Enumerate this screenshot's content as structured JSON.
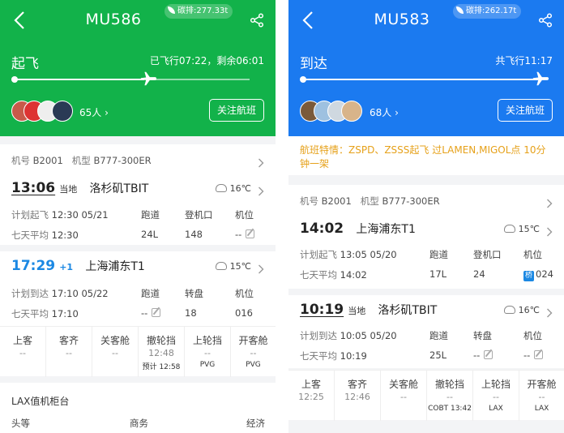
{
  "left": {
    "flight_no": "MU586",
    "carbon": "碳排:277.33t",
    "status": "起飞",
    "progress_text": "已飞行07:22，剩余06:01",
    "progress": 0.55,
    "pax": "65人",
    "follow_label": "关注航班",
    "aircraft_reg_label": "机号",
    "aircraft_reg": "B2001",
    "aircraft_type_label": "机型",
    "aircraft_type": "B777-300ER",
    "dep": {
      "time": "13:06",
      "local": "当地",
      "airport": "洛杉矶TBIT",
      "temp": "16℃",
      "plan_label": "计划起飞",
      "plan": "12:30 05/21",
      "avg_label": "七天平均",
      "avg": "12:30",
      "col1_label": "跑道",
      "col1": "24L",
      "col2_label": "登机口",
      "col2": "148",
      "col3_label": "机位",
      "col3": "--"
    },
    "arr": {
      "time": "17:29",
      "plus": "+1",
      "airport": "上海浦东T1",
      "temp": "15℃",
      "plan_label": "计划到达",
      "plan": "17:10 05/22",
      "avg_label": "七天平均",
      "avg": "17:10",
      "col1_label": "跑道",
      "col1": "--",
      "col2_label": "转盘",
      "col2": "18",
      "col3_label": "机位",
      "col3": "016"
    },
    "steps": [
      {
        "label": "上客",
        "value": "--",
        "sub": ""
      },
      {
        "label": "客齐",
        "value": "--",
        "sub": ""
      },
      {
        "label": "关客舱",
        "value": "--",
        "sub": ""
      },
      {
        "label": "撤轮挡",
        "value": "12:48",
        "sub": "预计 12:58"
      },
      {
        "label": "上轮挡",
        "value": "--",
        "sub": "PVG"
      },
      {
        "label": "开客舱",
        "value": "--",
        "sub": "PVG"
      }
    ],
    "counter_title": "LAX值机柜台",
    "counter_classes": [
      "头等",
      "商务",
      "经济"
    ]
  },
  "right": {
    "flight_no": "MU583",
    "carbon": "碳排:262.17t",
    "status": "到达",
    "progress_text": "共飞行11:17",
    "progress": 1.0,
    "pax": "68人",
    "follow_label": "关注航班",
    "notice": "航班特情：ZSPD、ZSSS起飞 过LAMEN,MIGOL点 10分钟一架",
    "aircraft_reg_label": "机号",
    "aircraft_reg": "B2001",
    "aircraft_type_label": "机型",
    "aircraft_type": "B777-300ER",
    "dep": {
      "time": "14:02",
      "airport": "上海浦东T1",
      "temp": "15℃",
      "plan_label": "计划起飞",
      "plan": "13:05 05/20",
      "avg_label": "七天平均",
      "avg": "14:02",
      "col1_label": "跑道",
      "col1": "17L",
      "col2_label": "登机口",
      "col2": "24",
      "col3_label": "机位",
      "col3_badge": "桥",
      "col3": "024"
    },
    "arr": {
      "time": "10:19",
      "local": "当地",
      "airport": "洛杉矶TBIT",
      "temp": "16℃",
      "plan_label": "计划到达",
      "plan": "10:05 05/20",
      "avg_label": "七天平均",
      "avg": "10:19",
      "col1_label": "跑道",
      "col1": "25L",
      "col2_label": "转盘",
      "col2": "--",
      "col3_label": "机位",
      "col3": "--"
    },
    "steps": [
      {
        "label": "上客",
        "value": "12:25",
        "sub": ""
      },
      {
        "label": "客齐",
        "value": "12:46",
        "sub": ""
      },
      {
        "label": "关客舱",
        "value": "--",
        "sub": ""
      },
      {
        "label": "撤轮挡",
        "value": "--",
        "sub": "COBT 13:42"
      },
      {
        "label": "上轮挡",
        "value": "--",
        "sub": "LAX"
      },
      {
        "label": "开客舱",
        "value": "--",
        "sub": "LAX"
      }
    ]
  },
  "colors": {
    "left_header": "#12b24a",
    "right_header": "#1b7af0",
    "notice_text": "#e6a11a",
    "plus_day": "#1b88e3"
  }
}
